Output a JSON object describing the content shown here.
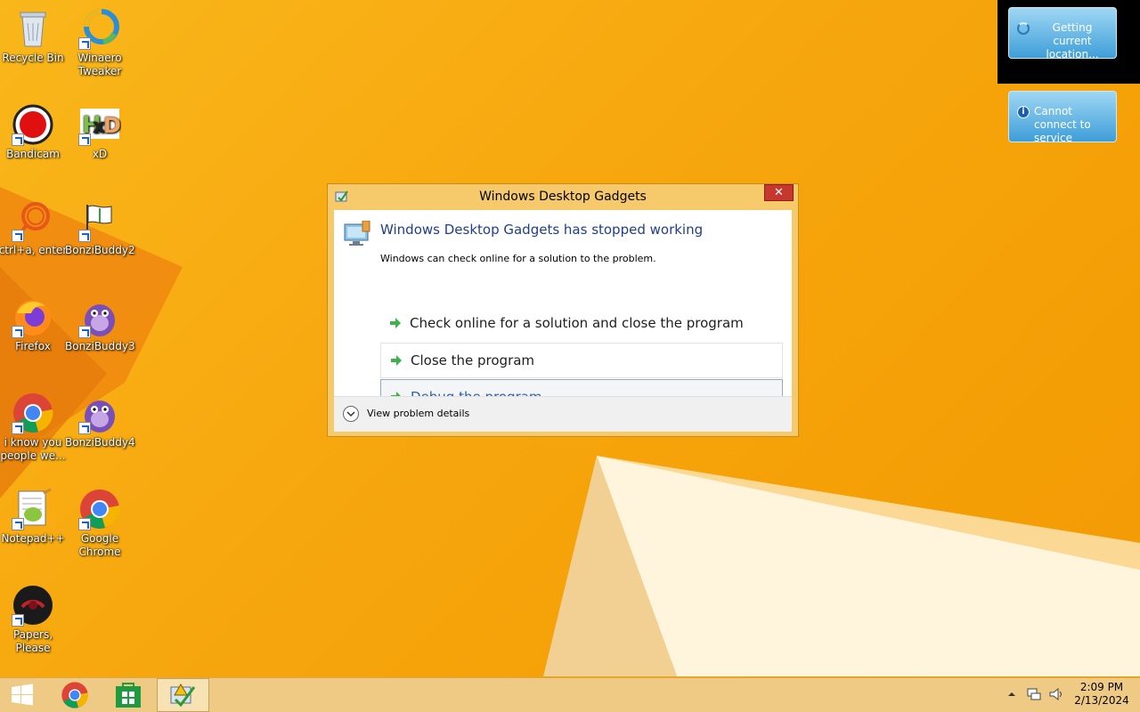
{
  "desktop": {
    "icons": [
      {
        "label": "Recycle Bin",
        "icon": "recycle-bin-icon"
      },
      {
        "label": "Winaero Tweaker",
        "icon": "winaero-tweaker-icon"
      },
      {
        "label": "Bandicam",
        "icon": "bandicam-icon"
      },
      {
        "label": "xD",
        "icon": "hxd-icon"
      },
      {
        "label": "ctrl+a, enter",
        "icon": "search-shortcut-icon"
      },
      {
        "label": "BonziBuddy2",
        "icon": "bonzibuddy-flag-icon"
      },
      {
        "label": "Firefox",
        "icon": "firefox-icon"
      },
      {
        "label": "BonziBuddy3",
        "icon": "bonzibuddy-icon"
      },
      {
        "label": "i know you people we...",
        "icon": "chrome-icon"
      },
      {
        "label": "BonziBuddy4",
        "icon": "bonzibuddy-icon"
      },
      {
        "label": "Notepad++",
        "icon": "notepad-plus-plus-icon"
      },
      {
        "label": "Google Chrome",
        "icon": "chrome-icon"
      },
      {
        "label": "Papers, Please",
        "icon": "papers-please-icon"
      }
    ]
  },
  "gadgets": {
    "weather": {
      "text": "Getting current location..."
    },
    "status": {
      "text": "Cannot connect to service"
    }
  },
  "dialog": {
    "title": "Windows Desktop Gadgets",
    "close_label": "✕",
    "heading": "Windows Desktop Gadgets has stopped working",
    "description": "Windows can check online for a solution to the problem.",
    "options": [
      {
        "label": "Check online for a solution and close the program"
      },
      {
        "label": "Close the program"
      },
      {
        "label": "Debug the program"
      }
    ],
    "details_label": "View problem details"
  },
  "taskbar": {
    "buttons": [
      {
        "icon": "windows-start-icon"
      },
      {
        "icon": "chrome-icon"
      },
      {
        "icon": "store-icon"
      },
      {
        "icon": "error-reporting-icon",
        "active": true
      }
    ],
    "tray": {
      "time": "2:09 PM",
      "date": "2/13/2024"
    }
  },
  "colors": {
    "accent": "#1e3f8a",
    "wallpaper": "#f7a80f",
    "close": "#c7372e"
  }
}
